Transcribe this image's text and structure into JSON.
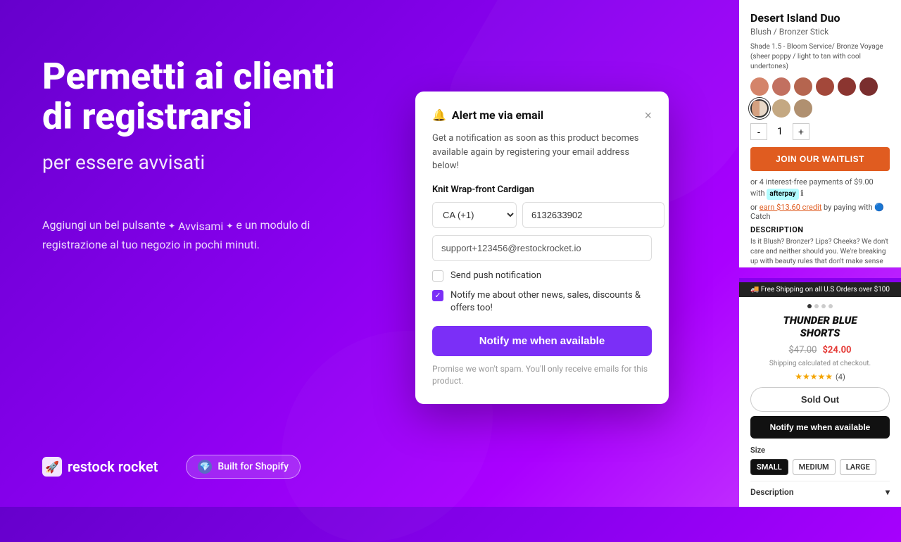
{
  "background": {
    "gradient_start": "#6600cc",
    "gradient_end": "#aa00ff"
  },
  "hero": {
    "title": "Permetti ai clienti di registrarsi",
    "subtitle": "per essere avvisati",
    "description_part1": "Aggiungi un bel pulsante",
    "description_avvisami": "Avvisami",
    "description_part2": "e un modulo di registrazione al tuo negozio in pochi minuti."
  },
  "brand": {
    "icon": "🚀",
    "name": "restock rocket"
  },
  "shopify_badge": {
    "label": "Built for Shopify",
    "icon": "💎"
  },
  "modal": {
    "title": "Alert me via email",
    "bell": "🔔",
    "close": "×",
    "description": "Get a notification as soon as this product becomes available again by registering your email address below!",
    "product_label": "Knit Wrap-front Cardigan",
    "phone_country": "CA (+1)",
    "phone_number": "6132633902",
    "email_placeholder": "support+123456@restockrocket.io",
    "checkbox_push": {
      "label": "Send push notification",
      "checked": false
    },
    "checkbox_news": {
      "label": "Notify me about other news, sales, discounts & offers too!",
      "checked": true
    },
    "notify_button": "Notify me when available",
    "disclaimer": "Promise we won't spam. You'll only receive emails for this product."
  },
  "product_top": {
    "name": "Desert Island Duo",
    "type": "Blush / Bronzer Stick",
    "shade_label": "Shade 1.5 - Bloom Service/ Bronze Voyage (sheer poppy / light to tan with cool undertones)",
    "swatches": [
      {
        "color": "#d4846a"
      },
      {
        "color": "#c27060"
      },
      {
        "color": "#b5654f"
      },
      {
        "color": "#a3483a"
      },
      {
        "color": "#8b3530"
      },
      {
        "color": "#7a2e2e"
      },
      {
        "color": "#6b3d2a",
        "selected": true
      },
      {
        "color": "#4a2e1e"
      },
      {
        "color": "#f5c4b0"
      }
    ],
    "quantity": 1,
    "waitlist_button": "JOIN OUR WAITLIST",
    "afterpay_text": "or 4 interest-free payments of $9.00 with",
    "afterpay_badge": "afterpay",
    "catch_text": "or earn $13.60 credit by paying with",
    "catch_badge": "Catch",
    "description_title": "DESCRIPTION",
    "description_text": "Is it Blush? Bronzer? Lips? Cheeks? We don't care and neither should you. We're breaking up with beauty rules that don't make sense to streamline your routine. Each duo amps up your features so you can feel good instantly. Layer and stack for endless possibilities."
  },
  "product_bottom": {
    "shipping_bar": "🚚 Free Shipping on all U.S Orders over $100",
    "title_line1": "THUNDER BLUE",
    "title_line2": "SHORTS",
    "price_original": "$47.00",
    "price_sale": "$24.00",
    "shipping_note": "Shipping calculated at checkout.",
    "stars": "★★★★★",
    "review_count": "(4)",
    "sold_out_button": "Sold Out",
    "notify_button": "Notify me when available",
    "size_label": "Size",
    "sizes": [
      "SMALL",
      "MEDIUM",
      "LARGE"
    ],
    "size_selected": "SMALL",
    "description_toggle": "Description"
  }
}
